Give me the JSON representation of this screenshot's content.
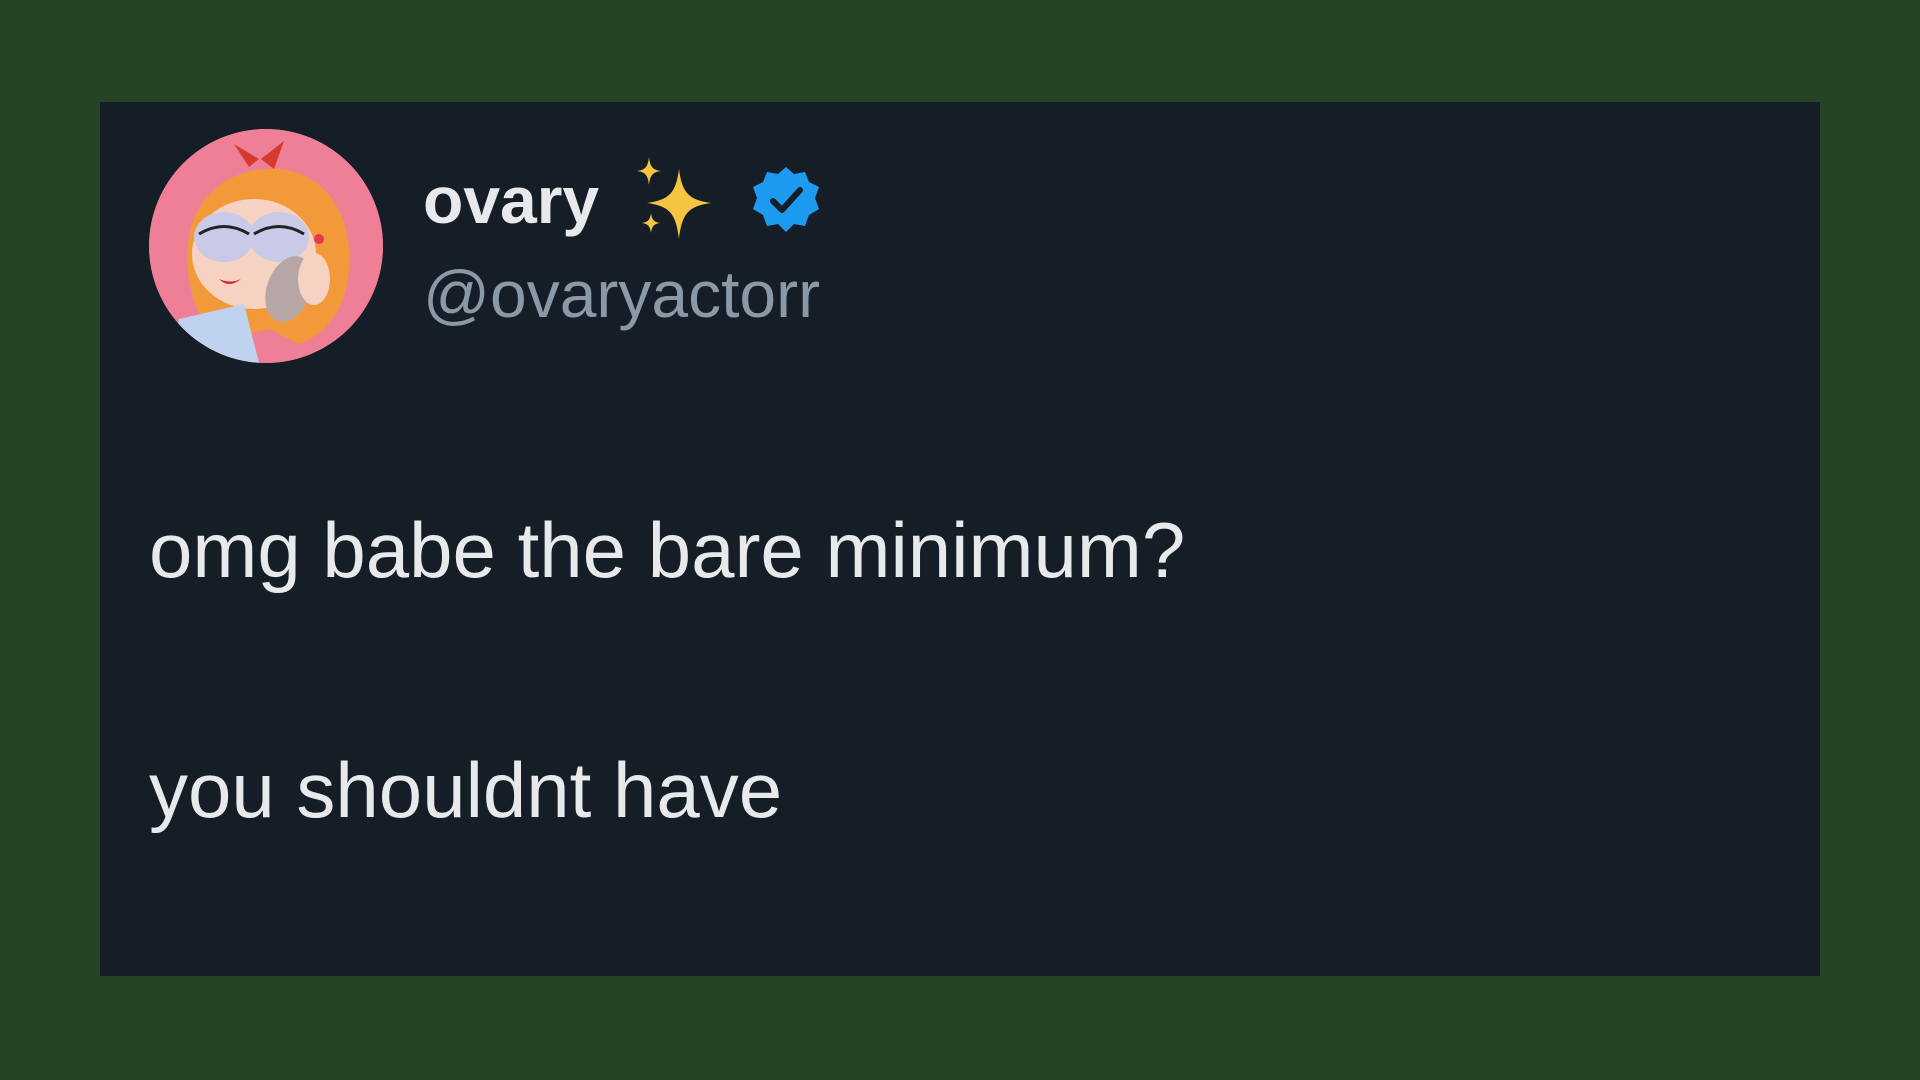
{
  "tweet": {
    "author": {
      "display_name": "ovary",
      "handle": "@ovaryactorr",
      "avatar_icon": "cartoon-girl-avatar",
      "emoji_icon": "sparkles-icon",
      "badge_icon": "verified-badge-icon"
    },
    "text_lines": [
      "omg babe the bare minimum?",
      "you shouldnt have"
    ]
  },
  "colors": {
    "page_background": "#264425",
    "card_background": "#151d27",
    "primary_text": "#e7e9ea",
    "secondary_text": "#8b98a5",
    "verified_blue": "#1d9bf0",
    "sparkle_yellow": "#f5c542"
  }
}
